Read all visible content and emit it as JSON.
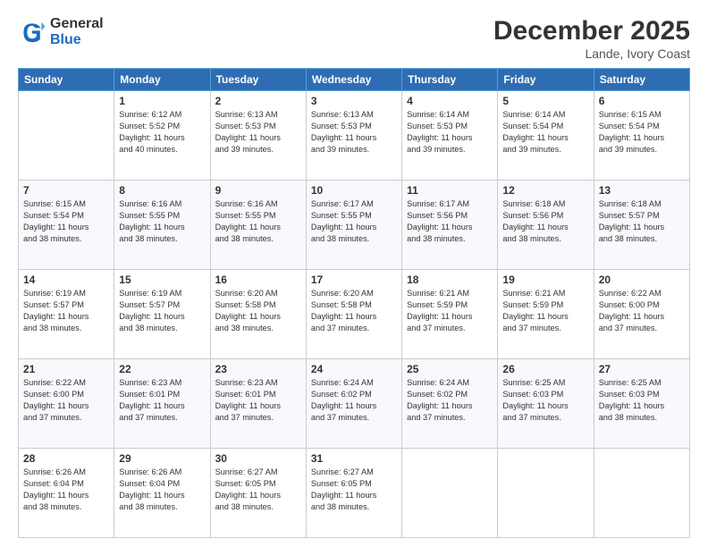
{
  "logo": {
    "general": "General",
    "blue": "Blue"
  },
  "header": {
    "month": "December 2025",
    "location": "Lande, Ivory Coast"
  },
  "weekdays": [
    "Sunday",
    "Monday",
    "Tuesday",
    "Wednesday",
    "Thursday",
    "Friday",
    "Saturday"
  ],
  "weeks": [
    [
      {
        "day": "",
        "info": ""
      },
      {
        "day": "1",
        "info": "Sunrise: 6:12 AM\nSunset: 5:52 PM\nDaylight: 11 hours\nand 40 minutes."
      },
      {
        "day": "2",
        "info": "Sunrise: 6:13 AM\nSunset: 5:53 PM\nDaylight: 11 hours\nand 39 minutes."
      },
      {
        "day": "3",
        "info": "Sunrise: 6:13 AM\nSunset: 5:53 PM\nDaylight: 11 hours\nand 39 minutes."
      },
      {
        "day": "4",
        "info": "Sunrise: 6:14 AM\nSunset: 5:53 PM\nDaylight: 11 hours\nand 39 minutes."
      },
      {
        "day": "5",
        "info": "Sunrise: 6:14 AM\nSunset: 5:54 PM\nDaylight: 11 hours\nand 39 minutes."
      },
      {
        "day": "6",
        "info": "Sunrise: 6:15 AM\nSunset: 5:54 PM\nDaylight: 11 hours\nand 39 minutes."
      }
    ],
    [
      {
        "day": "7",
        "info": "Sunrise: 6:15 AM\nSunset: 5:54 PM\nDaylight: 11 hours\nand 38 minutes."
      },
      {
        "day": "8",
        "info": "Sunrise: 6:16 AM\nSunset: 5:55 PM\nDaylight: 11 hours\nand 38 minutes."
      },
      {
        "day": "9",
        "info": "Sunrise: 6:16 AM\nSunset: 5:55 PM\nDaylight: 11 hours\nand 38 minutes."
      },
      {
        "day": "10",
        "info": "Sunrise: 6:17 AM\nSunset: 5:55 PM\nDaylight: 11 hours\nand 38 minutes."
      },
      {
        "day": "11",
        "info": "Sunrise: 6:17 AM\nSunset: 5:56 PM\nDaylight: 11 hours\nand 38 minutes."
      },
      {
        "day": "12",
        "info": "Sunrise: 6:18 AM\nSunset: 5:56 PM\nDaylight: 11 hours\nand 38 minutes."
      },
      {
        "day": "13",
        "info": "Sunrise: 6:18 AM\nSunset: 5:57 PM\nDaylight: 11 hours\nand 38 minutes."
      }
    ],
    [
      {
        "day": "14",
        "info": "Sunrise: 6:19 AM\nSunset: 5:57 PM\nDaylight: 11 hours\nand 38 minutes."
      },
      {
        "day": "15",
        "info": "Sunrise: 6:19 AM\nSunset: 5:57 PM\nDaylight: 11 hours\nand 38 minutes."
      },
      {
        "day": "16",
        "info": "Sunrise: 6:20 AM\nSunset: 5:58 PM\nDaylight: 11 hours\nand 38 minutes."
      },
      {
        "day": "17",
        "info": "Sunrise: 6:20 AM\nSunset: 5:58 PM\nDaylight: 11 hours\nand 37 minutes."
      },
      {
        "day": "18",
        "info": "Sunrise: 6:21 AM\nSunset: 5:59 PM\nDaylight: 11 hours\nand 37 minutes."
      },
      {
        "day": "19",
        "info": "Sunrise: 6:21 AM\nSunset: 5:59 PM\nDaylight: 11 hours\nand 37 minutes."
      },
      {
        "day": "20",
        "info": "Sunrise: 6:22 AM\nSunset: 6:00 PM\nDaylight: 11 hours\nand 37 minutes."
      }
    ],
    [
      {
        "day": "21",
        "info": "Sunrise: 6:22 AM\nSunset: 6:00 PM\nDaylight: 11 hours\nand 37 minutes."
      },
      {
        "day": "22",
        "info": "Sunrise: 6:23 AM\nSunset: 6:01 PM\nDaylight: 11 hours\nand 37 minutes."
      },
      {
        "day": "23",
        "info": "Sunrise: 6:23 AM\nSunset: 6:01 PM\nDaylight: 11 hours\nand 37 minutes."
      },
      {
        "day": "24",
        "info": "Sunrise: 6:24 AM\nSunset: 6:02 PM\nDaylight: 11 hours\nand 37 minutes."
      },
      {
        "day": "25",
        "info": "Sunrise: 6:24 AM\nSunset: 6:02 PM\nDaylight: 11 hours\nand 37 minutes."
      },
      {
        "day": "26",
        "info": "Sunrise: 6:25 AM\nSunset: 6:03 PM\nDaylight: 11 hours\nand 37 minutes."
      },
      {
        "day": "27",
        "info": "Sunrise: 6:25 AM\nSunset: 6:03 PM\nDaylight: 11 hours\nand 38 minutes."
      }
    ],
    [
      {
        "day": "28",
        "info": "Sunrise: 6:26 AM\nSunset: 6:04 PM\nDaylight: 11 hours\nand 38 minutes."
      },
      {
        "day": "29",
        "info": "Sunrise: 6:26 AM\nSunset: 6:04 PM\nDaylight: 11 hours\nand 38 minutes."
      },
      {
        "day": "30",
        "info": "Sunrise: 6:27 AM\nSunset: 6:05 PM\nDaylight: 11 hours\nand 38 minutes."
      },
      {
        "day": "31",
        "info": "Sunrise: 6:27 AM\nSunset: 6:05 PM\nDaylight: 11 hours\nand 38 minutes."
      },
      {
        "day": "",
        "info": ""
      },
      {
        "day": "",
        "info": ""
      },
      {
        "day": "",
        "info": ""
      }
    ]
  ]
}
